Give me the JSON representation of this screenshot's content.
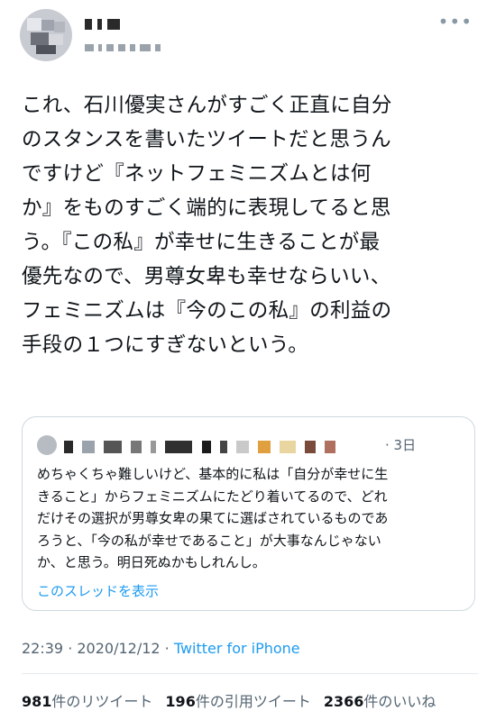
{
  "author": {
    "avatar_icon": "blurred-avatar"
  },
  "tweet": {
    "text": "これ、石川優実さんがすごく正直に自分\nのスタンスを書いたツイートだと思うん\nですけど『ネットフェミニズムとは何\nか』をものすごく端的に表現してると思\nう。『この私』が幸せに生きることが最\n優先なので、男尊女卑も幸せならいい、\nフェミニズムは『今のこの私』の利益の\n手段の１つにすぎないという。"
  },
  "quote": {
    "time": "· 3日",
    "text": "めちゃくちゃ難しいけど、基本的に私は「自分が幸せに生\nきること」からフェミニズムにたどり着いてるので、どれ\nだけその選択が男尊女卑の果てに選ばされているものであ\nろうと、「今の私が幸せであること」が大事なんじゃない\nか、と思う。明日死ぬかもしれんし。",
    "show_thread": "このスレッドを表示"
  },
  "meta": {
    "datetime": "22:39 · 2020/12/12 · ",
    "client": "Twitter for iPhone"
  },
  "stats": {
    "retweets_count": "981",
    "retweets_label": "件のリツイート",
    "quotes_count": "196",
    "quotes_label": "件の引用ツイート",
    "likes_count": "2366",
    "likes_label": "件のいいね"
  },
  "colors": {
    "accent": "#1d9bf0",
    "secondary_text": "#536471",
    "border": "#cfd9de"
  }
}
